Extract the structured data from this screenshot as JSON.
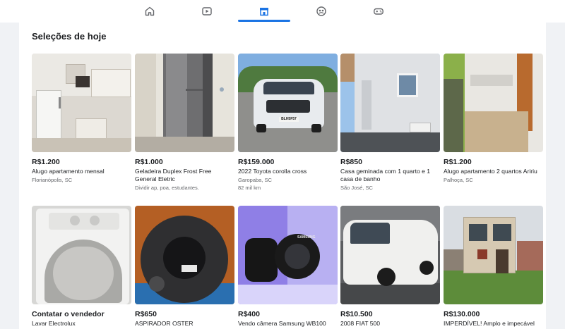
{
  "nav": {
    "tabs": [
      {
        "icon": "home-icon",
        "active": false
      },
      {
        "icon": "video-icon",
        "active": false
      },
      {
        "icon": "marketplace-icon",
        "active": true
      },
      {
        "icon": "groups-icon",
        "active": false
      },
      {
        "icon": "gaming-icon",
        "active": false
      }
    ]
  },
  "section": {
    "title": "Seleções de hoje"
  },
  "listings": [
    {
      "price": "R$1.200",
      "title": "Alugo apartamento mensal",
      "location": "Florianópolis, SC",
      "extra": ""
    },
    {
      "price": "R$1.000",
      "title": "Geladeira Duplex Frost Free General Eletric",
      "location": "Dividir ap, poa, estudantes.",
      "extra": ""
    },
    {
      "price": "R$159.000",
      "title": "2022 Toyota corolla cross",
      "location": "Garopaba, SC",
      "extra": "82 mil km"
    },
    {
      "price": "R$850",
      "title": "Casa geminada com 1 quarto e 1 casa de banho",
      "location": "São José, SC",
      "extra": ""
    },
    {
      "price": "R$1.200",
      "title": "Alugo apartamento 2 quartos Aririu",
      "location": "Palhoça, SC",
      "extra": ""
    },
    {
      "price": "Contatar o vendedor",
      "title": "Lavar Electrolux",
      "location": "",
      "extra": ""
    },
    {
      "price": "R$650",
      "title": "ASPIRADOR OSTER",
      "location": "",
      "extra": ""
    },
    {
      "price": "R$400",
      "title": "Vendo câmera Samsung WB100",
      "location": "",
      "extra": ""
    },
    {
      "price": "R$10.500",
      "title": "2008 FIAT 500",
      "location": "",
      "extra": ""
    },
    {
      "price": "R$130.000",
      "title": "IMPERDÍVEL! Amplo e impecável",
      "location": "",
      "extra": ""
    }
  ],
  "image_text": {
    "plate": "BLH5F57",
    "camera_brand": "SAMSUNG"
  }
}
